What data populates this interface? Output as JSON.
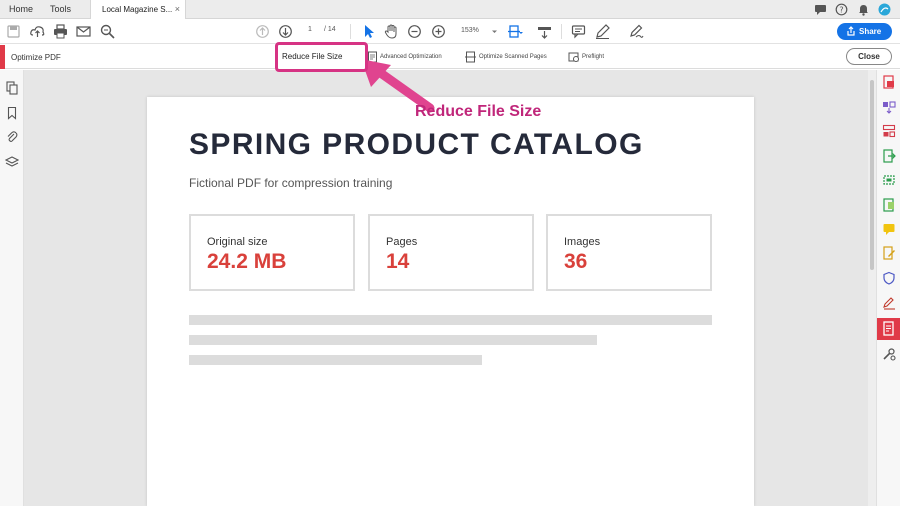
{
  "tabs": {
    "home": "Home",
    "tools": "Tools",
    "document": "Local Magazine S...",
    "close_glyph": "×"
  },
  "toolbar": {
    "page_current": "1",
    "page_total": "/ 14",
    "zoom": "153%",
    "share_label": "Share"
  },
  "optimize_bar": {
    "title": "Optimize PDF",
    "reduce": "Reduce File Size",
    "advanced": "Advanced Optimization",
    "scanned": "Optimize Scanned Pages",
    "preflight": "Preflight",
    "close": "Close"
  },
  "document": {
    "title": "SPRING PRODUCT CATALOG",
    "subtitle": "Fictional PDF for compression training",
    "cards": [
      {
        "label": "Original size",
        "value": "24.2 MB"
      },
      {
        "label": "Pages",
        "value": "14"
      },
      {
        "label": "Images",
        "value": "36"
      }
    ]
  },
  "annotation": {
    "label": "Reduce File Size"
  },
  "colors": {
    "accent": "#1473e6",
    "highlight": "#d63384",
    "value_red": "#d9413b"
  }
}
